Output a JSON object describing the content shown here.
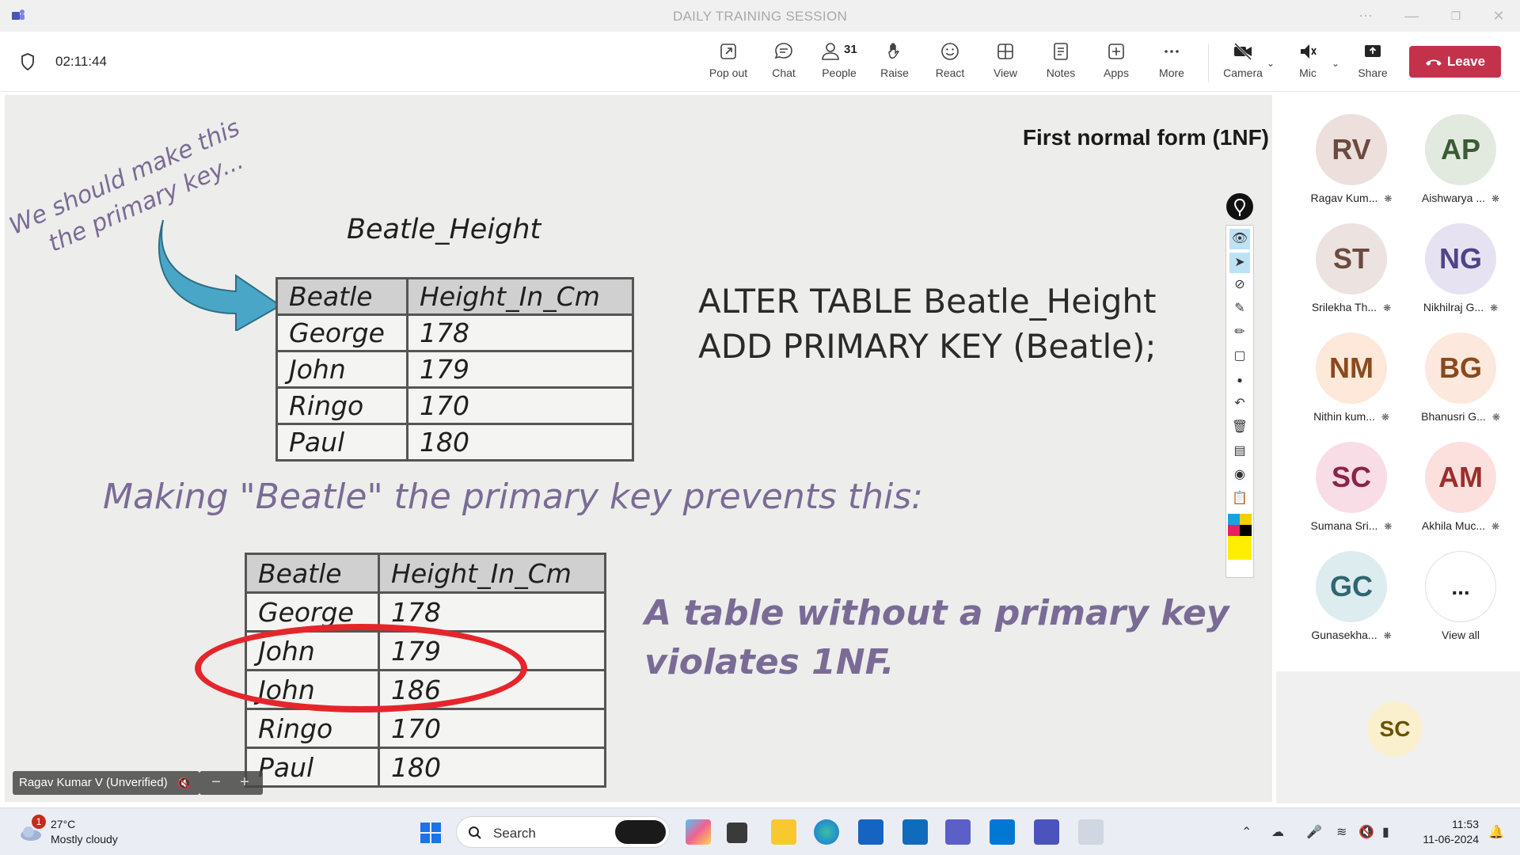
{
  "window": {
    "title": "DAILY TRAINING SESSION"
  },
  "meeting": {
    "timer": "02:11:44",
    "toolbar": {
      "pop_out": "Pop out",
      "chat": "Chat",
      "people": "People",
      "people_count": "31",
      "raise": "Raise",
      "react": "React",
      "view": "View",
      "notes": "Notes",
      "apps": "Apps",
      "more": "More",
      "camera": "Camera",
      "mic": "Mic",
      "share": "Share",
      "leave": "Leave"
    },
    "presenter_label": "Ragav Kumar V (Unverified)"
  },
  "slide": {
    "title": "First normal form (1NF)",
    "annotation_line1": "We should make this",
    "annotation_line2": "the primary key...",
    "table_title": "Beatle_Height",
    "table1": {
      "headers": [
        "Beatle",
        "Height_In_Cm"
      ],
      "rows": [
        [
          "George",
          "178"
        ],
        [
          "John",
          "179"
        ],
        [
          "Ringo",
          "170"
        ],
        [
          "Paul",
          "180"
        ]
      ]
    },
    "sql_line1": "ALTER TABLE Beatle_Height",
    "sql_line2": "ADD PRIMARY KEY (Beatle);",
    "making_text": "Making \"Beatle\" the primary key prevents this:",
    "table2": {
      "headers": [
        "Beatle",
        "Height_In_Cm"
      ],
      "rows": [
        [
          "George",
          "178"
        ],
        [
          "John",
          "179"
        ],
        [
          "John",
          "186"
        ],
        [
          "Ringo",
          "170"
        ],
        [
          "Paul",
          "180"
        ]
      ]
    },
    "violates_line1": "A table without a primary key",
    "violates_line2": "violates 1NF."
  },
  "participants": [
    {
      "initials": "RV",
      "name": "Ragav Kum...",
      "bg": "#ecdfdc",
      "fg": "#6b4a40"
    },
    {
      "initials": "AP",
      "name": "Aishwarya ...",
      "bg": "#e2eae0",
      "fg": "#3c5a36"
    },
    {
      "initials": "ST",
      "name": "Srilekha Th...",
      "bg": "#ece2df",
      "fg": "#6b4a40"
    },
    {
      "initials": "NG",
      "name": "Nikhilraj G...",
      "bg": "#e6e2f2",
      "fg": "#4f4585"
    },
    {
      "initials": "NM",
      "name": "Nithin kum...",
      "bg": "#fde8da",
      "fg": "#8a4a1c"
    },
    {
      "initials": "BG",
      "name": "Bhanusri G...",
      "bg": "#fce8dc",
      "fg": "#8a4a1c"
    },
    {
      "initials": "SC",
      "name": "Sumana Sri...",
      "bg": "#f8dde6",
      "fg": "#8a2448"
    },
    {
      "initials": "AM",
      "name": "Akhila Muc...",
      "bg": "#fbe0de",
      "fg": "#9a2f2a"
    },
    {
      "initials": "GC",
      "name": "Gunasekha...",
      "bg": "#dcecef",
      "fg": "#2f6670"
    },
    {
      "initials": "...",
      "name": "View all",
      "bg": "#ffffff",
      "fg": "#242424"
    }
  ],
  "self_view": {
    "initials": "SC"
  },
  "taskbar": {
    "weather_badge": "1",
    "temperature": "27°C",
    "weather": "Mostly cloudy",
    "search": "Search",
    "time": "11:53",
    "date": "11-06-2024"
  }
}
